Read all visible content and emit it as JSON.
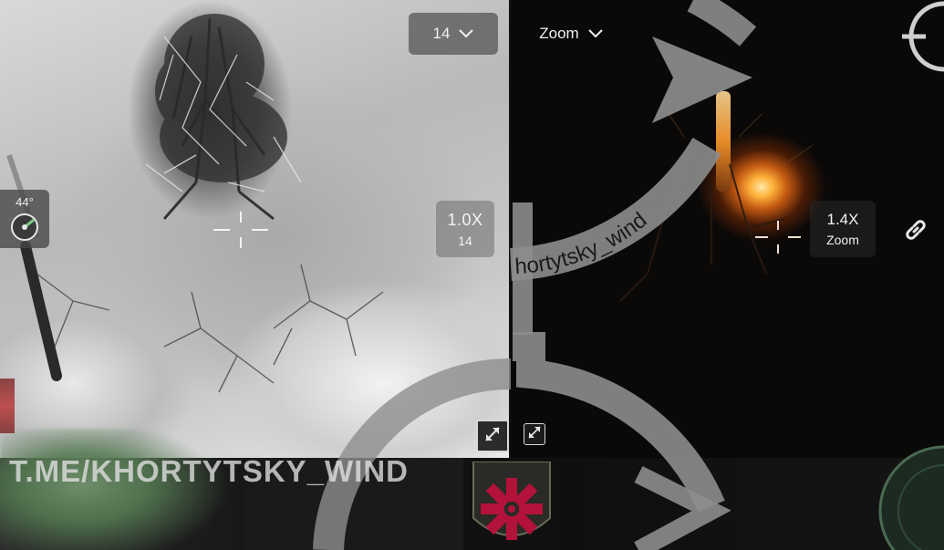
{
  "left_feed": {
    "zoom_dropdown": {
      "value": "14",
      "chevron_icon": "chevron-down-icon"
    },
    "zoom_readout": {
      "zoom": "1.0X",
      "sub": "14"
    },
    "compass": {
      "heading": "44°",
      "icon": "compass-dial-icon"
    },
    "fullscreen_icon": "fullscreen-toggle-icon"
  },
  "right_feed": {
    "zoom_dropdown": {
      "label": "Zoom",
      "chevron_icon": "chevron-down-icon"
    },
    "zoom_readout": {
      "zoom": "1.4X",
      "sub": "Zoom"
    },
    "link_icon": "link-icon",
    "fullscreen_icon": "fullscreen-toggle-icon"
  },
  "overlay": {
    "watermark": "T.ME/KHORTYTSKY_WIND",
    "ring_text": "hortytsky_wind",
    "emblem_icon": "unit-emblem-star-icon"
  },
  "colors": {
    "ring": "#8d8d8d",
    "chip_bg": "#5a5a5a",
    "fire": "#ffb13a",
    "emblem_red": "#b3123a"
  }
}
